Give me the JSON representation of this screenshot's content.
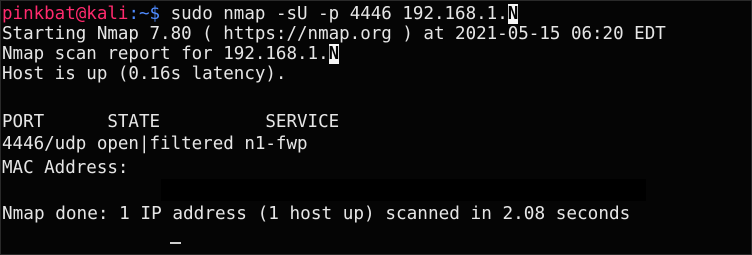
{
  "terminal": {
    "prompt": {
      "user_host": "pinkbat@kali",
      "path": ":~$",
      "command": " sudo nmap -sU -p 4446 192.168.1.",
      "command_highlight": "N"
    },
    "lines": {
      "starting": "Starting Nmap 7.80 ( https://nmap.org ) at 2021-05-15 06:20 EDT",
      "report_prefix": "Nmap scan report for 192.168.1.",
      "report_highlight": "N",
      "host_up": "Host is up (0.16s latency).",
      "table_header": "PORT      STATE          SERVICE",
      "table_row": "4446/udp open|filtered n1-fwp",
      "mac": "MAC Address:",
      "done": "Nmap done: 1 IP address (1 host up) scanned in 2.08 seconds"
    }
  }
}
